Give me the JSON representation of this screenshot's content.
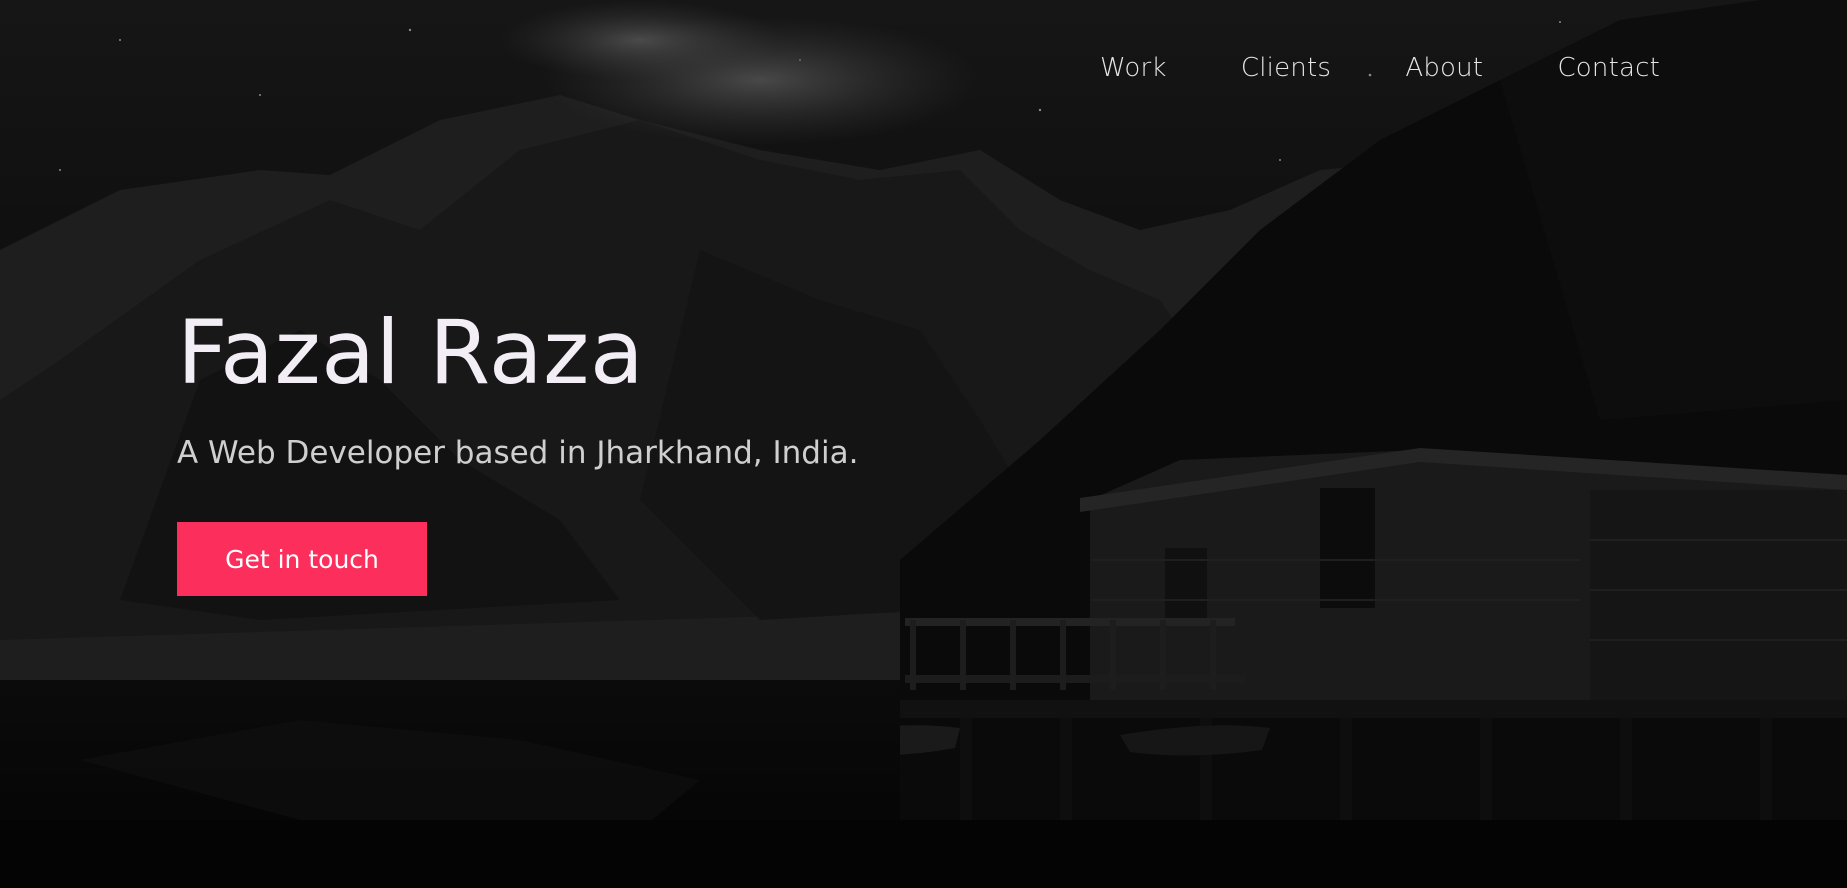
{
  "nav": {
    "items": [
      {
        "label": "Work"
      },
      {
        "label": "Clients"
      },
      {
        "label": "About"
      },
      {
        "label": "Contact"
      }
    ]
  },
  "hero": {
    "title": "Fazal Raza",
    "subtitle": "A Web Developer based in Jharkhand, India.",
    "cta_label": "Get in touch"
  },
  "colors": {
    "accent": "#fc2e5b",
    "background": "#050505",
    "title_text": "#f3eef6",
    "subtitle_text": "#cfcfcf",
    "nav_text": "#e6e6e6"
  },
  "background_image": "dark-mountain-lake-cabin-photo"
}
